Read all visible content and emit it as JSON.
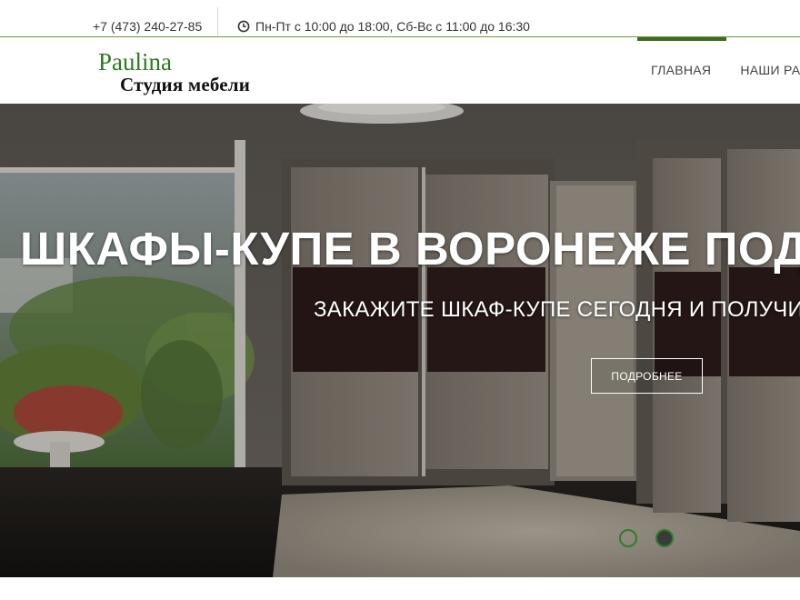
{
  "topbar": {
    "phone": "+7 (473) 240-27-85",
    "hours": "Пн-Пт с 10:00 до 18:00, Сб-Вс с 11:00 до 16:30",
    "hours_icon": "clock-icon"
  },
  "logo": {
    "brand": "Paulina",
    "tagline": "Студия мебели"
  },
  "nav": {
    "items": [
      {
        "label": "ГЛАВНАЯ",
        "active": true
      },
      {
        "label": "НАШИ РАБОТЫ",
        "active": false
      }
    ]
  },
  "hero": {
    "title": "ШКАФЫ-КУПЕ В ВОРОНЕЖЕ ПОД ЗАКАЗ",
    "subtitle": "ЗАКАЖИТЕ ШКАФ-КУПЕ СЕГОДНЯ И ПОЛУЧИТЕ СКИДКУ",
    "button_label": "ПОДРОБНЕЕ",
    "slides": 2,
    "active_slide": 2
  },
  "colors": {
    "accent": "#3d6b22",
    "brand_green": "#2a7a1d",
    "topbar_border": "#6f9a3a"
  }
}
